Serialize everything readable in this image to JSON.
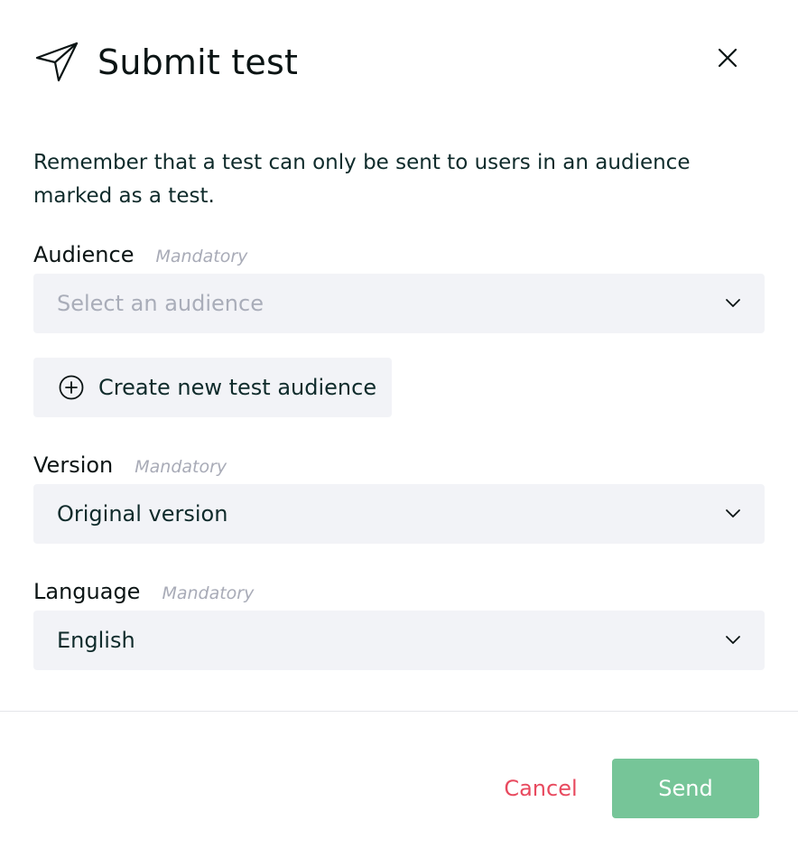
{
  "header": {
    "title": "Submit test",
    "icon": "send-icon",
    "close_icon": "close-icon"
  },
  "intro_text": "Remember that a test can only be sent to users in an audience marked as a test.",
  "fields": {
    "audience": {
      "label": "Audience",
      "mandatory": "Mandatory",
      "placeholder": "Select an audience",
      "value": ""
    },
    "create_audience": {
      "label": "Create new test audience",
      "icon": "plus-circle-icon"
    },
    "version": {
      "label": "Version",
      "mandatory": "Mandatory",
      "value": "Original version"
    },
    "language": {
      "label": "Language",
      "mandatory": "Mandatory",
      "value": "English"
    }
  },
  "footer": {
    "cancel_label": "Cancel",
    "send_label": "Send"
  },
  "colors": {
    "cancel": "#e84a5f",
    "send_bg": "#76c598",
    "field_bg": "#f2f3f7",
    "mandatory": "#a8abb7",
    "text": "#0f2b2b"
  }
}
